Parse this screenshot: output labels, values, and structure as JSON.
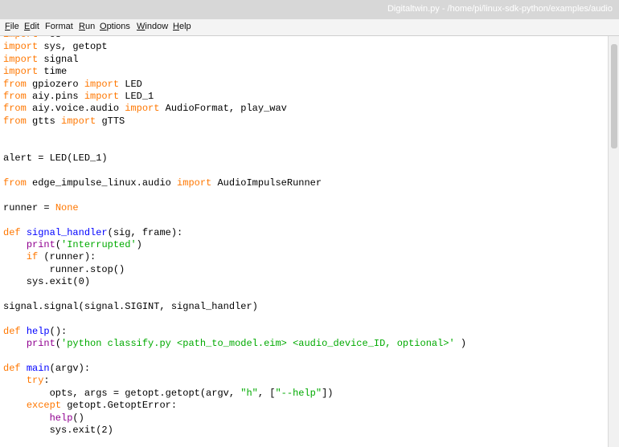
{
  "window": {
    "title": "Digitaltwin.py - /home/pi/linux-sdk-python/examples/audio"
  },
  "menu": [
    {
      "u": "F",
      "rest": "ile"
    },
    {
      "u": "E",
      "rest": "dit"
    },
    {
      "u": "",
      "rest": "Format"
    },
    {
      "u": "R",
      "rest": "un"
    },
    {
      "u": "O",
      "rest": "ptions"
    },
    {
      "u": "W",
      "rest": "indow"
    },
    {
      "u": "H",
      "rest": "elp"
    }
  ],
  "code_lines": [
    [
      [
        "kw",
        "import"
      ],
      [
        "",
        "  os"
      ]
    ],
    [
      [
        "kw",
        "import"
      ],
      [
        "",
        " sys, getopt"
      ]
    ],
    [
      [
        "kw",
        "import"
      ],
      [
        "",
        " signal"
      ]
    ],
    [
      [
        "kw",
        "import"
      ],
      [
        "",
        " time"
      ]
    ],
    [
      [
        "kw",
        "from"
      ],
      [
        "",
        " gpiozero "
      ],
      [
        "kw",
        "import"
      ],
      [
        "",
        " LED"
      ]
    ],
    [
      [
        "kw",
        "from"
      ],
      [
        "",
        " aiy.pins "
      ],
      [
        "kw",
        "import"
      ],
      [
        "",
        " LED_1"
      ]
    ],
    [
      [
        "kw",
        "from"
      ],
      [
        "",
        " aiy.voice.audio "
      ],
      [
        "kw",
        "import"
      ],
      [
        "",
        " AudioFormat, play_wav"
      ]
    ],
    [
      [
        "kw",
        "from"
      ],
      [
        "",
        " gtts "
      ],
      [
        "kw",
        "import"
      ],
      [
        "",
        " gTTS"
      ]
    ],
    [],
    [],
    [
      [
        "",
        "alert = LED(LED_1)"
      ]
    ],
    [],
    [
      [
        "kw",
        "from"
      ],
      [
        "",
        " edge_impulse_linux.audio "
      ],
      [
        "kw",
        "import"
      ],
      [
        "",
        " AudioImpulseRunner"
      ]
    ],
    [],
    [
      [
        "",
        "runner = "
      ],
      [
        "kw",
        "None"
      ]
    ],
    [],
    [
      [
        "kw",
        "def"
      ],
      [
        "",
        " "
      ],
      [
        "def",
        "signal_handler"
      ],
      [
        "",
        "(sig, frame):"
      ]
    ],
    [
      [
        "",
        "    "
      ],
      [
        "builtin",
        "print"
      ],
      [
        "",
        "("
      ],
      [
        "str",
        "'Interrupted'"
      ],
      [
        ")",
        ")"
      ]
    ],
    [
      [
        "",
        "    "
      ],
      [
        "kw",
        "if"
      ],
      [
        "",
        " (runner):"
      ]
    ],
    [
      [
        "",
        "        runner.stop()"
      ]
    ],
    [
      [
        "",
        "    sys.exit(0)"
      ]
    ],
    [],
    [
      [
        "",
        "signal.signal(signal.SIGINT, signal_handler)"
      ]
    ],
    [],
    [
      [
        "kw",
        "def"
      ],
      [
        "",
        " "
      ],
      [
        "def",
        "help"
      ],
      [
        "",
        "():"
      ]
    ],
    [
      [
        "",
        "    "
      ],
      [
        "builtin",
        "print"
      ],
      [
        "",
        "("
      ],
      [
        "str",
        "'python classify.py <path_to_model.eim> <audio_device_ID, optional>'"
      ],
      [
        "",
        " )"
      ]
    ],
    [],
    [
      [
        "kw",
        "def"
      ],
      [
        "",
        " "
      ],
      [
        "def",
        "main"
      ],
      [
        "",
        "(argv):"
      ]
    ],
    [
      [
        "",
        "    "
      ],
      [
        "kw",
        "try"
      ],
      [
        "",
        ":"
      ]
    ],
    [
      [
        "",
        "        opts, args = getopt.getopt(argv, "
      ],
      [
        "str",
        "\"h\""
      ],
      [
        "",
        ", ["
      ],
      [
        "str",
        "\"--help\""
      ],
      [
        "",
        "])"
      ]
    ],
    [
      [
        "",
        "    "
      ],
      [
        "kw",
        "except"
      ],
      [
        "",
        " getopt.GetoptError:"
      ]
    ],
    [
      [
        "",
        "        "
      ],
      [
        "builtin",
        "help"
      ],
      [
        "",
        "()"
      ]
    ],
    [
      [
        "",
        "        sys.exit(2)"
      ]
    ]
  ]
}
